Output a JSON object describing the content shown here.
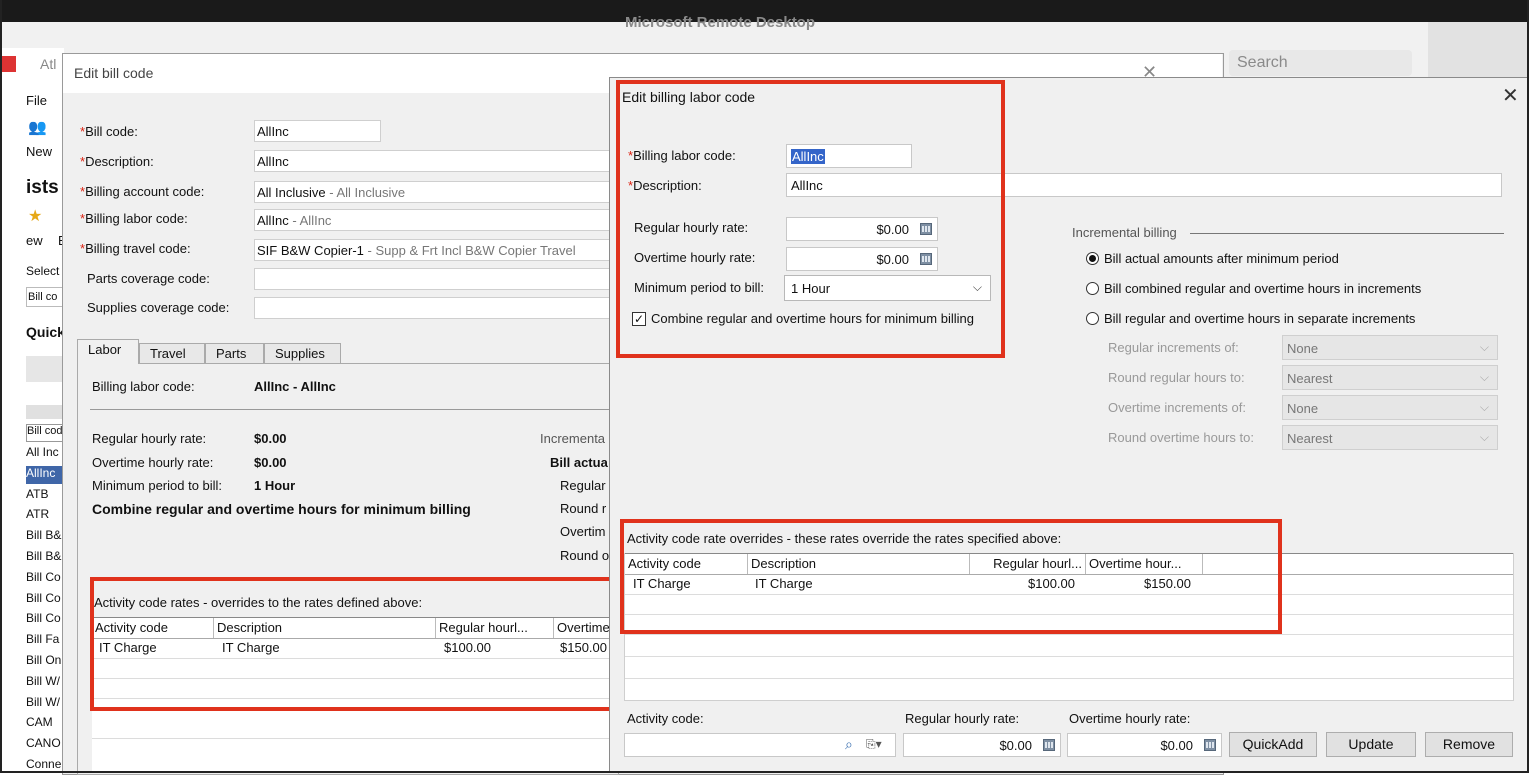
{
  "remote_desktop": {
    "title": "Microsoft Remote Desktop",
    "search_placeholder": "Search"
  },
  "background_app": {
    "app_name": "Atl",
    "menu_file": "File",
    "new_label": "New",
    "lists_heading": "ists",
    "view_label": "ew",
    "view_label2": "E",
    "select_label": "Select",
    "bill_code_select": "Bill co",
    "quick_label": "Quick",
    "list_header": "Bill cod",
    "list_items": [
      "All Inc",
      "AllInc",
      "ATB",
      "ATR",
      "Bill B&",
      "Bill B&",
      "Bill Co",
      "Bill Co",
      "Bill Co",
      "Bill Fa",
      "Bill On",
      "Bill W/",
      "Bill W/",
      "CAM",
      "CANO",
      "Conne"
    ],
    "selected_index": 1
  },
  "edit_bill_code": {
    "title": "Edit bill code",
    "fields": {
      "bill_code": {
        "label": "Bill code:",
        "value": "AllInc"
      },
      "description": {
        "label": "Description:",
        "value": "AllInc"
      },
      "billing_account_code": {
        "label": "Billing account code:",
        "value": "All Inclusive",
        "sub": " - All Inclusive"
      },
      "billing_labor_code": {
        "label": "Billing labor code:",
        "value": "AllInc",
        "sub": " - AllInc"
      },
      "billing_travel_code": {
        "label": "Billing travel code:",
        "value": "SIF B&W Copier-1",
        "sub": " - Supp & Frt Incl B&W Copier Travel"
      },
      "parts_coverage_code": {
        "label": "Parts coverage code:",
        "value": ""
      },
      "supplies_coverage_code": {
        "label": "Supplies coverage code:",
        "value": ""
      }
    },
    "tabs": [
      "Labor",
      "Travel",
      "Parts",
      "Supplies"
    ],
    "active_tab": "Labor",
    "labor": {
      "billing_labor_code_label": "Billing labor code:",
      "billing_labor_code_value": "AllInc - AllInc",
      "regular_rate_label": "Regular hourly rate:",
      "regular_rate_value": "$0.00",
      "overtime_rate_label": "Overtime hourly rate:",
      "overtime_rate_value": "$0.00",
      "min_period_label": "Minimum period to bill:",
      "min_period_value": "1 Hour",
      "combine_text": "Combine regular and overtime hours for minimum billing",
      "incremental_label": "Incrementa",
      "bill_actual_label": "Bill actua",
      "regular_label": "Regular",
      "round_label": "Round r",
      "overtime_label": "Overtim",
      "round_o_label": "Round o"
    },
    "activity_rates": {
      "heading": "Activity code rates - overrides to the rates defined above:",
      "columns": [
        "Activity code",
        "Description",
        "Regular hourl...",
        "Overtime"
      ],
      "rows": [
        {
          "activity": "IT Charge",
          "description": "IT Charge",
          "regular": "$100.00",
          "overtime": "$150.00"
        }
      ]
    }
  },
  "edit_billing_labor_code": {
    "title": "Edit billing labor code",
    "billing_labor_code_label": "Billing labor code:",
    "billing_labor_code_value": "AllInc",
    "description_label": "Description:",
    "description_value": "AllInc",
    "regular_rate_label": "Regular hourly rate:",
    "regular_rate_value": "$0.00",
    "overtime_rate_label": "Overtime hourly rate:",
    "overtime_rate_value": "$0.00",
    "min_period_label": "Minimum period to bill:",
    "min_period_value": "1 Hour",
    "combine_label": "Combine regular and overtime hours for minimum billing",
    "combine_checked": true,
    "incremental": {
      "heading": "Incremental billing",
      "options": [
        "Bill actual amounts after minimum period",
        "Bill combined regular and overtime hours in increments",
        "Bill regular and overtime hours in separate increments"
      ],
      "selected_index": 0,
      "regular_increments_label": "Regular increments of:",
      "regular_increments_value": "None",
      "round_regular_label": "Round regular hours to:",
      "round_regular_value": "Nearest",
      "overtime_increments_label": "Overtime increments of:",
      "overtime_increments_value": "None",
      "round_overtime_label": "Round overtime hours to:",
      "round_overtime_value": "Nearest"
    },
    "overrides": {
      "heading": "Activity code rate overrides - these rates override the rates specified above:",
      "columns": [
        "Activity code",
        "Description",
        "Regular hourl...",
        "Overtime hour..."
      ],
      "rows": [
        {
          "activity": "IT Charge",
          "description": "IT Charge",
          "regular": "$100.00",
          "overtime": "$150.00"
        }
      ]
    },
    "footer": {
      "activity_code_label": "Activity code:",
      "activity_code_value": "",
      "regular_rate_label": "Regular hourly rate:",
      "regular_rate_value": "$0.00",
      "overtime_rate_label": "Overtime hourly rate:",
      "overtime_rate_value": "$0.00",
      "quickadd_label": "QuickAdd",
      "update_label": "Update",
      "remove_label": "Remove"
    }
  },
  "colors": {
    "highlight_box": "#e0321c",
    "selection_blue": "#3465c9",
    "required_star": "#d21111"
  }
}
